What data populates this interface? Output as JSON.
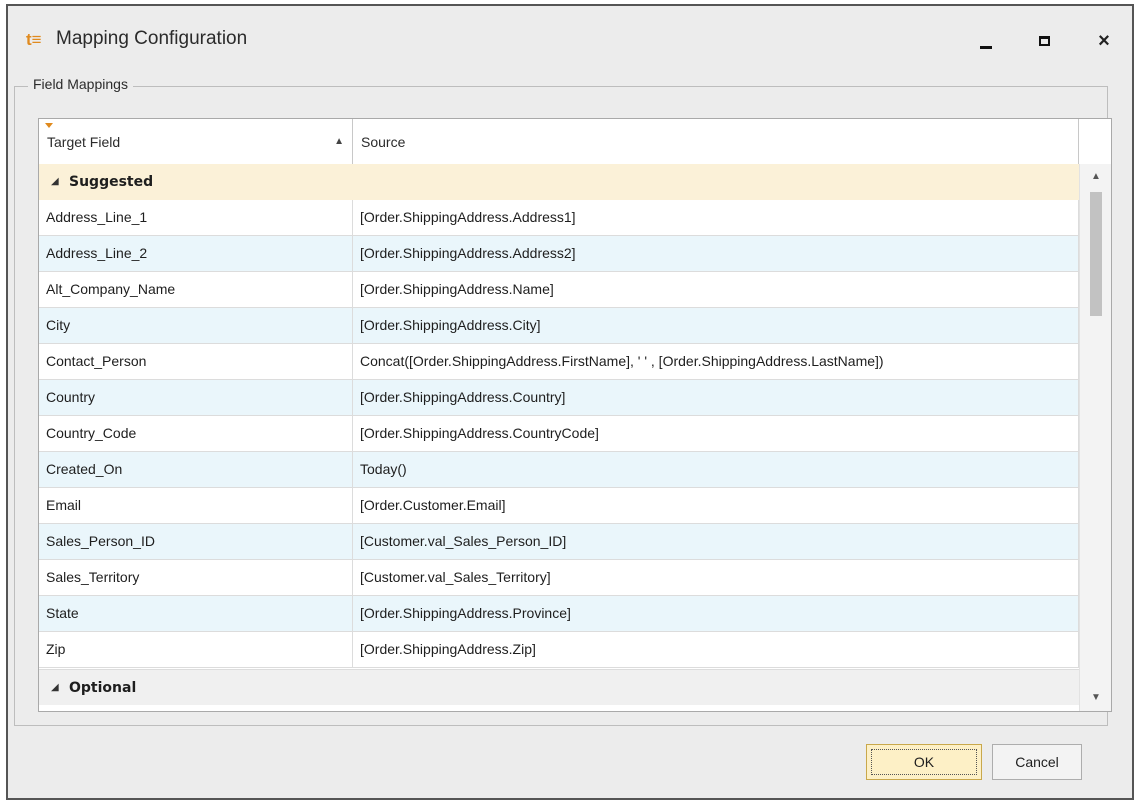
{
  "window": {
    "title": "Mapping Configuration",
    "app_icon": "t≡",
    "close_glyph": "×"
  },
  "groupbox": {
    "label": "Field Mappings"
  },
  "grid": {
    "columns": [
      "Target Field",
      "Source"
    ],
    "sorted_column": "Target Field",
    "sort_direction": "ascending",
    "groups": [
      {
        "label": "Suggested",
        "expanded": true
      },
      {
        "label": "Optional",
        "expanded": true
      }
    ],
    "rows": [
      {
        "target": "Address_Line_1",
        "source": "[Order.ShippingAddress.Address1]"
      },
      {
        "target": "Address_Line_2",
        "source": "[Order.ShippingAddress.Address2]"
      },
      {
        "target": "Alt_Company_Name",
        "source": "[Order.ShippingAddress.Name]"
      },
      {
        "target": "City",
        "source": "[Order.ShippingAddress.City]"
      },
      {
        "target": "Contact_Person",
        "source": "Concat([Order.ShippingAddress.FirstName], ' ' , [Order.ShippingAddress.LastName])"
      },
      {
        "target": "Country",
        "source": "[Order.ShippingAddress.Country]"
      },
      {
        "target": "Country_Code",
        "source": "[Order.ShippingAddress.CountryCode]"
      },
      {
        "target": "Created_On",
        "source": "Today()"
      },
      {
        "target": "Email",
        "source": "[Order.Customer.Email]"
      },
      {
        "target": "Sales_Person_ID",
        "source": "[Customer.val_Sales_Person_ID]"
      },
      {
        "target": "Sales_Territory",
        "source": "[Customer.val_Sales_Territory]"
      },
      {
        "target": "State",
        "source": "[Order.ShippingAddress.Province]"
      },
      {
        "target": "Zip",
        "source": "[Order.ShippingAddress.Zip]"
      }
    ]
  },
  "buttons": {
    "ok": "OK",
    "cancel": "Cancel"
  },
  "colors": {
    "group_header_bg": "#fbf1d8",
    "alt_row_bg": "#eaf6fb",
    "ok_button_bg": "#fdf0c6"
  }
}
